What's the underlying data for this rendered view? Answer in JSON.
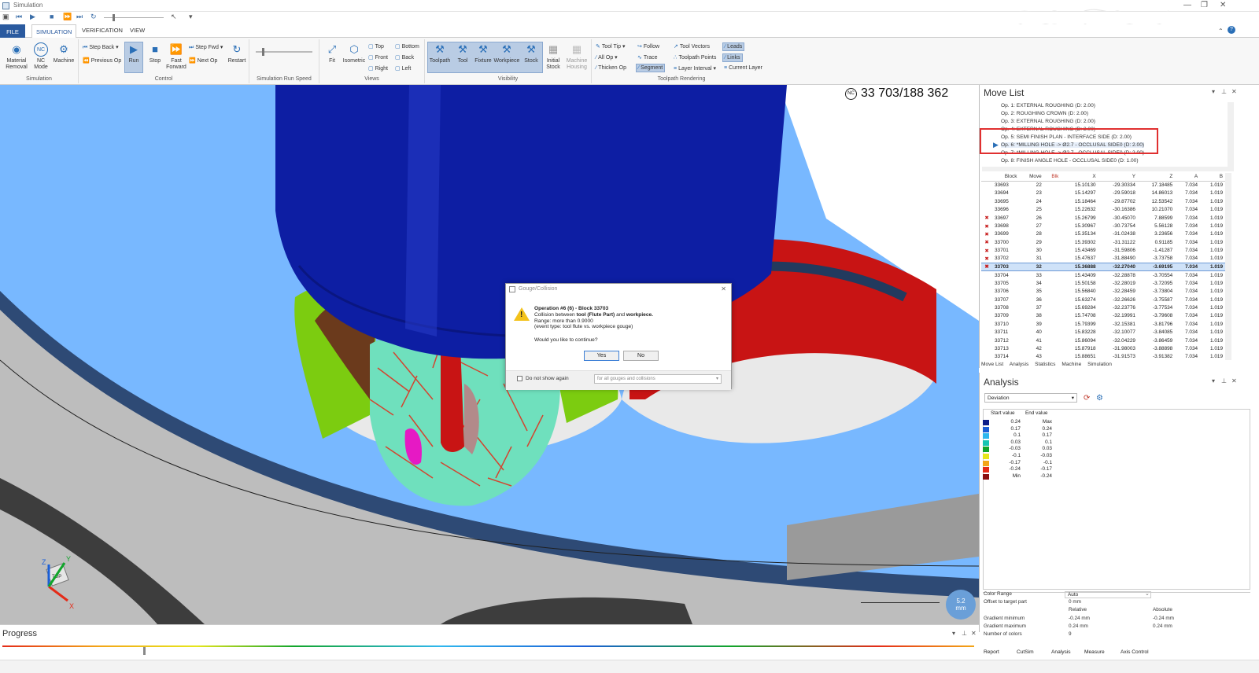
{
  "app": {
    "title": "Simulation"
  },
  "tabs": [
    {
      "label": "FILE"
    },
    {
      "label": "SIMULATION"
    },
    {
      "label": "VERIFICATION"
    },
    {
      "label": "VIEW"
    }
  ],
  "ribbon": {
    "groups": {
      "simulation": "Simulation",
      "control": "Control",
      "speed": "Simulation Run Speed",
      "views": "Views",
      "visibility": "Visibility",
      "rendering": "Toolpath Rendering"
    },
    "simulation": {
      "material": "Material\nRemoval",
      "nc": "NC\nMode",
      "machine": "Machine"
    },
    "control": {
      "step_back": "Step Back",
      "previous_op": "Previous Op",
      "run": "Run",
      "stop": "Stop",
      "fast_forward": "Fast\nForward",
      "step_fwd": "Step Fwd",
      "next_op": "Next Op",
      "restart": "Restart"
    },
    "views": {
      "fit": "Fit",
      "isometric": "Isometric",
      "top": "Top",
      "front": "Front",
      "right": "Right",
      "bottom": "Bottom",
      "back": "Back",
      "left": "Left"
    },
    "visibility": {
      "toolpath": "Toolpath",
      "tool": "Tool",
      "fixture": "Fixture",
      "workpiece": "Workpiece",
      "stock": "Stock",
      "initial_stock": "Initial\nStock",
      "machine_housing": "Machine\nHousing"
    },
    "rendering": {
      "tool_tip": "Tool Tip",
      "all_op": "All Op",
      "thicken_op": "Thicken Op",
      "follow": "Follow",
      "trace": "Trace",
      "segment": "Segment",
      "tool_vectors": "Tool Vectors",
      "toolpath_points": "Toolpath Points",
      "layer_interval": "Layer Interval",
      "leads": "Leads",
      "links": "Links",
      "current_layer": "Current Layer"
    }
  },
  "viewport": {
    "nc_badge": "NC",
    "nc_counter": "33 703/188 362",
    "scale_value": "5.2",
    "scale_unit": "mm",
    "axis_z": "Z",
    "axis_y": "Y",
    "axis_x": "X",
    "cube_label": "TOP"
  },
  "dialog": {
    "title": "Gouge/Collision",
    "heading": "Operation #6 (6) - Block 33703",
    "line1_pre": "Collision between ",
    "line1_tool": "tool (Flute Part)",
    "line1_mid": " and ",
    "line1_wp": "workpiece.",
    "line2": "Range: more than 0.9000",
    "line3": "(event type: tool flute vs. workpiece gouge)",
    "question": "Would you like to continue?",
    "yes": "Yes",
    "no": "No",
    "dont_show": "Do not show again",
    "scope": "for all gouges and collisions"
  },
  "movelist": {
    "title": "Move List",
    "ops": [
      "Op. 1: EXTERNAL ROUGHING  (D: 2.00)",
      "Op. 2: ROUGHING CROWN (D: 2.00)",
      "Op. 3: EXTERNAL ROUGHING  (D: 2.00)",
      "Op. 4: EXTERNAL ROUGHING  (D: 2.00)",
      "Op. 5: SEMI FINISH PLAN - INTERFACE SIDE (D: 2.00)",
      "Op. 6: *MILLING HOLE -> Ø2.7 - OCCLUSAL SIDE0 (D: 2.00)",
      "Op. 7: *MILLING HOLE -> Ø2.7 - OCCLUSAL SIDE0 (D: 2.00)",
      "Op. 8: FINISH ANGLE HOLE - OCCLUSAL SIDE0 (D: 1.00)"
    ],
    "columns": [
      "Block",
      "Move",
      "Blk",
      "X",
      "Y",
      "Z",
      "A",
      "B"
    ],
    "rows": [
      [
        "33693",
        "22",
        "15.10130",
        "-29.30334",
        "17.18485",
        "7.034",
        "1.019"
      ],
      [
        "33694",
        "23",
        "15.14297",
        "-29.59018",
        "14.86013",
        "7.034",
        "1.019"
      ],
      [
        "33695",
        "24",
        "15.18464",
        "-29.87702",
        "12.53542",
        "7.034",
        "1.019"
      ],
      [
        "33696",
        "25",
        "15.22632",
        "-30.16386",
        "10.21070",
        "7.034",
        "1.019"
      ],
      [
        "33697",
        "26",
        "15.26799",
        "-30.45070",
        "7.88599",
        "7.034",
        "1.019"
      ],
      [
        "33698",
        "27",
        "15.30967",
        "-30.73754",
        "5.56128",
        "7.034",
        "1.019"
      ],
      [
        "33699",
        "28",
        "15.35134",
        "-31.02438",
        "3.23656",
        "7.034",
        "1.019"
      ],
      [
        "33700",
        "29",
        "15.39302",
        "-31.31122",
        "0.91185",
        "7.034",
        "1.019"
      ],
      [
        "33701",
        "30",
        "15.43469",
        "-31.59806",
        "-1.41287",
        "7.034",
        "1.019"
      ],
      [
        "33702",
        "31",
        "15.47637",
        "-31.88490",
        "-3.73758",
        "7.034",
        "1.019"
      ],
      [
        "33703",
        "32",
        "15.36888",
        "-32.27040",
        "-3.69195",
        "7.034",
        "1.019"
      ],
      [
        "33704",
        "33",
        "15.43409",
        "-32.28878",
        "-3.70554",
        "7.034",
        "1.019"
      ],
      [
        "33705",
        "34",
        "15.50158",
        "-32.28019",
        "-3.72095",
        "7.034",
        "1.019"
      ],
      [
        "33706",
        "35",
        "15.56840",
        "-32.28459",
        "-3.73804",
        "7.034",
        "1.019"
      ],
      [
        "33707",
        "36",
        "15.63274",
        "-32.26626",
        "-3.75587",
        "7.034",
        "1.019"
      ],
      [
        "33708",
        "37",
        "15.69284",
        "-32.23776",
        "-3.77534",
        "7.034",
        "1.019"
      ],
      [
        "33709",
        "38",
        "15.74708",
        "-32.19991",
        "-3.79608",
        "7.034",
        "1.019"
      ],
      [
        "33710",
        "39",
        "15.79399",
        "-32.15381",
        "-3.81796",
        "7.034",
        "1.019"
      ],
      [
        "33711",
        "40",
        "15.83228",
        "-32.10077",
        "-3.84085",
        "7.034",
        "1.019"
      ],
      [
        "33712",
        "41",
        "15.86094",
        "-32.04229",
        "-3.86459",
        "7.034",
        "1.019"
      ],
      [
        "33713",
        "42",
        "15.87918",
        "-31.98003",
        "-3.88898",
        "7.034",
        "1.019"
      ],
      [
        "33714",
        "43",
        "15.88651",
        "-31.91573",
        "-3.91382",
        "7.034",
        "1.019"
      ]
    ],
    "tabs": [
      "Move List",
      "Analysis",
      "Statistics",
      "Machine",
      "Simulation"
    ]
  },
  "analysis": {
    "title": "Analysis",
    "dropdown": "Deviation",
    "col_start": "Start value",
    "col_end": "End value",
    "legend": [
      {
        "color": "#0d1e8a",
        "start": "0.24",
        "end": "Max"
      },
      {
        "color": "#1b5fd6",
        "start": "0.17",
        "end": "0.24"
      },
      {
        "color": "#2fb7ee",
        "start": "0.1",
        "end": "0.17"
      },
      {
        "color": "#17c5b3",
        "start": "0.03",
        "end": "0.1"
      },
      {
        "color": "#11a52b",
        "start": "-0.03",
        "end": "0.03"
      },
      {
        "color": "#e6e61b",
        "start": "-0.1",
        "end": "-0.03"
      },
      {
        "color": "#f3a617",
        "start": "-0.17",
        "end": "-0.1"
      },
      {
        "color": "#e42b18",
        "start": "-0.24",
        "end": "-0.17"
      },
      {
        "color": "#8b1010",
        "start": "Min",
        "end": "-0.24"
      }
    ],
    "color_range_label": "Color Range",
    "color_range_value": "Auto",
    "offset_label": "Offset to target part",
    "offset_value": "0 mm",
    "relative": "Relative",
    "absolute": "Absolute",
    "grad_min_label": "Gradient minimum",
    "grad_min_rel": "-0.24 mm",
    "grad_min_abs": "-0.24 mm",
    "grad_max_label": "Gradient maximum",
    "grad_max_rel": "0.24 mm",
    "grad_max_abs": "0.24 mm",
    "num_colors_label": "Number of colors",
    "num_colors_value": "9",
    "bottom_tabs": [
      "Report",
      "CutSim",
      "Analysis",
      "Measure",
      "Axis Control"
    ]
  },
  "progress": {
    "title": "Progress",
    "position": 0.145
  }
}
